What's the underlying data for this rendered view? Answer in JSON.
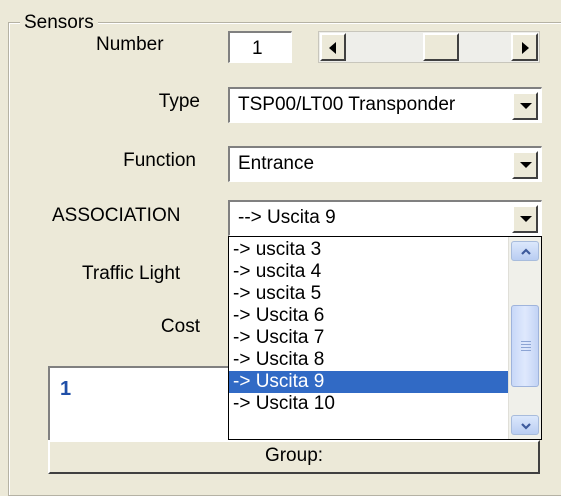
{
  "group": {
    "title": "Sensors"
  },
  "number": {
    "label": "Number",
    "value": "1"
  },
  "type": {
    "label": "Type",
    "value": "TSP00/LT00 Transponder"
  },
  "function": {
    "label": "Function",
    "value": "Entrance"
  },
  "association": {
    "label": "ASSOCIATION",
    "value": "--> Uscita  9",
    "options": [
      "-> uscita  3",
      "-> uscita  4",
      "-> uscita  5",
      "-> Uscita  6",
      "-> Uscita  7",
      "-> Uscita  8",
      "-> Uscita  9",
      "-> Uscita 10"
    ],
    "selected_index": 6
  },
  "traffic_light": {
    "label": "Traffic Light"
  },
  "cost": {
    "label": "Cost"
  },
  "list_box": {
    "first_item": "1"
  },
  "group_button": {
    "label": "Group:"
  },
  "icons": {
    "scroll_left": "triangle-left-icon",
    "scroll_right": "triangle-right-icon",
    "dropdown": "triangle-down-icon",
    "scroll_up": "chevron-up-icon",
    "scroll_down": "chevron-down-icon"
  },
  "colors": {
    "background": "#ece9d8",
    "selection": "#316ac5",
    "list_text": "#1f4fa8"
  }
}
